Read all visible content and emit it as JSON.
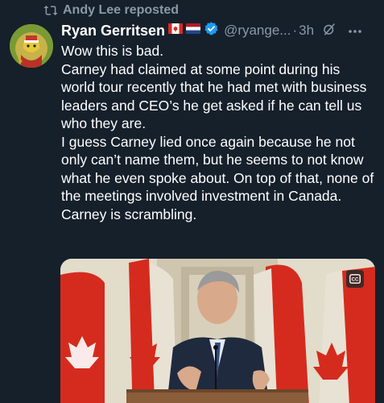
{
  "repost": {
    "text": "Andy Lee reposted",
    "icon": "repost-icon"
  },
  "author": {
    "name": "Ryan Gerritsen",
    "flags": [
      "canada-flag",
      "netherlands-flag"
    ],
    "verified_icon": "verified-badge-icon",
    "handle": "@ryange...",
    "separator": "·",
    "time": "3h"
  },
  "tweet": {
    "lines": [
      "Wow this is bad.",
      "Carney had claimed at some point during his world tour recently that he had met with business leaders and CEO’s he get asked if he can tell us who they are.",
      "I guess Carney lied once again because he not only can’t name them, but he seems to not know what he even spoke about. On top of that, none of the meetings involved investment in Canada.",
      "Carney is scrambling."
    ]
  },
  "media": {
    "badge_icon": "closed-captions-icon"
  },
  "colors": {
    "background": "#15202b",
    "secondary_text": "#8b98a5",
    "verified": "#1d9bf0",
    "canada_red": "#d52b1e"
  }
}
